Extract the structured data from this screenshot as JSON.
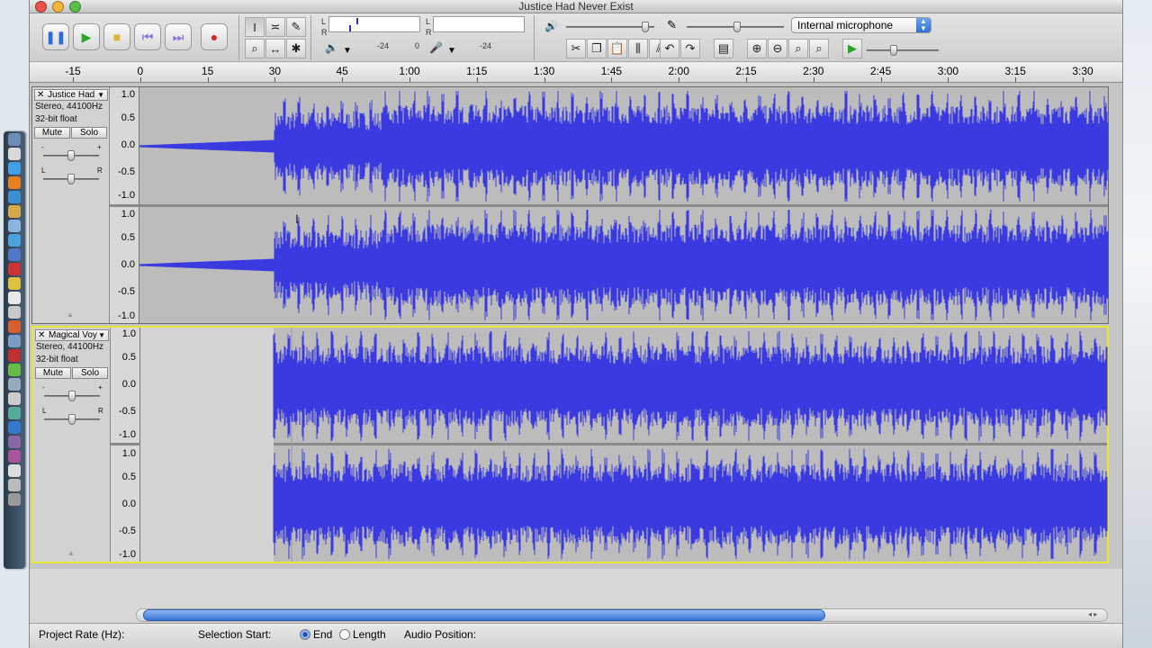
{
  "window": {
    "title": "Justice Had Never Exist"
  },
  "toolbar": {
    "transport": [
      "pause-icon",
      "play-icon",
      "stop-icon",
      "skip-start-icon",
      "skip-end-icon",
      "record-icon"
    ],
    "meter_out": {
      "l": "L",
      "r": "R",
      "minus24": "-24",
      "zero": "0"
    },
    "meter_in": {
      "l": "L",
      "r": "R",
      "minus24": "-24"
    },
    "input_device": "Internal microphone"
  },
  "ruler": {
    "ticks": [
      "-15",
      "0",
      "15",
      "30",
      "45",
      "1:00",
      "1:15",
      "1:30",
      "1:45",
      "2:00",
      "2:15",
      "2:30",
      "2:45",
      "3:00",
      "3:15",
      "3:30"
    ]
  },
  "tracks": [
    {
      "name": "Justice Had",
      "info1": "Stereo, 44100Hz",
      "info2": "32-bit float",
      "mute": "Mute",
      "solo": "Solo",
      "gain_minus": "-",
      "gain_plus": "+",
      "pan_l": "L",
      "pan_r": "R"
    },
    {
      "name": "Magical Voy",
      "info1": "Stereo, 44100Hz",
      "info2": "32-bit float",
      "mute": "Mute",
      "solo": "Solo",
      "gain_minus": "-",
      "gain_plus": "+",
      "pan_l": "L",
      "pan_r": "R"
    }
  ],
  "scale": {
    "v1": "1.0",
    "v05": "0.5",
    "v0": "0.0",
    "vm05": "-0.5",
    "vm1": "-1.0"
  },
  "status": {
    "project_rate": "Project Rate (Hz):",
    "selection_start": "Selection Start:",
    "end": "End",
    "length": "Length",
    "audio_position": "Audio Position:"
  },
  "colors": {
    "waveform": "#3a3ae0",
    "selected_border": "#e6e635"
  }
}
